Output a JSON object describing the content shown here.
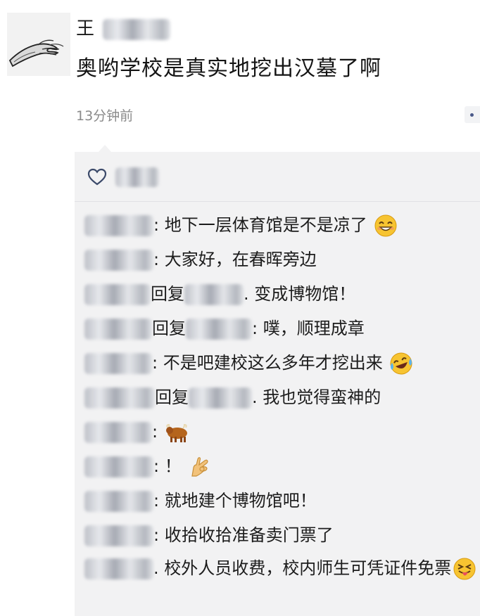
{
  "post": {
    "author": "王",
    "text": "奥哟学校是真实地挖出汉墓了啊",
    "time": "13分钟前"
  },
  "colors": {
    "panel": "#f2f2f3",
    "time": "#8a8a8a",
    "link": "#4a5a8a"
  },
  "comments": [
    {
      "text": ": 地下一层体育馆是不是凉了",
      "emoji": "grinning-face-emoji"
    },
    {
      "text": ": 大家好，在春晖旁边"
    },
    {
      "reply": "回复",
      "text": ". 变成博物馆！"
    },
    {
      "reply": "回复",
      "text": ": 噗，顺理成章"
    },
    {
      "text": ": 不是吧建校这么多年才挖出来",
      "emoji": "crying-laughing-emoji"
    },
    {
      "reply": "回复",
      "text": ". 我也觉得蛮神的"
    },
    {
      "text": ":",
      "emoji": "ox-emoji"
    },
    {
      "text": ": ！",
      "emoji": "ok-hand-emoji"
    },
    {
      "text": ": 就地建个博物馆吧！"
    },
    {
      "text": ": 收拾收拾准备卖门票了"
    },
    {
      "text": ". 校外人员收费，校内师生可凭证件免票",
      "emoji": "tongue-wink-emoji"
    }
  ]
}
